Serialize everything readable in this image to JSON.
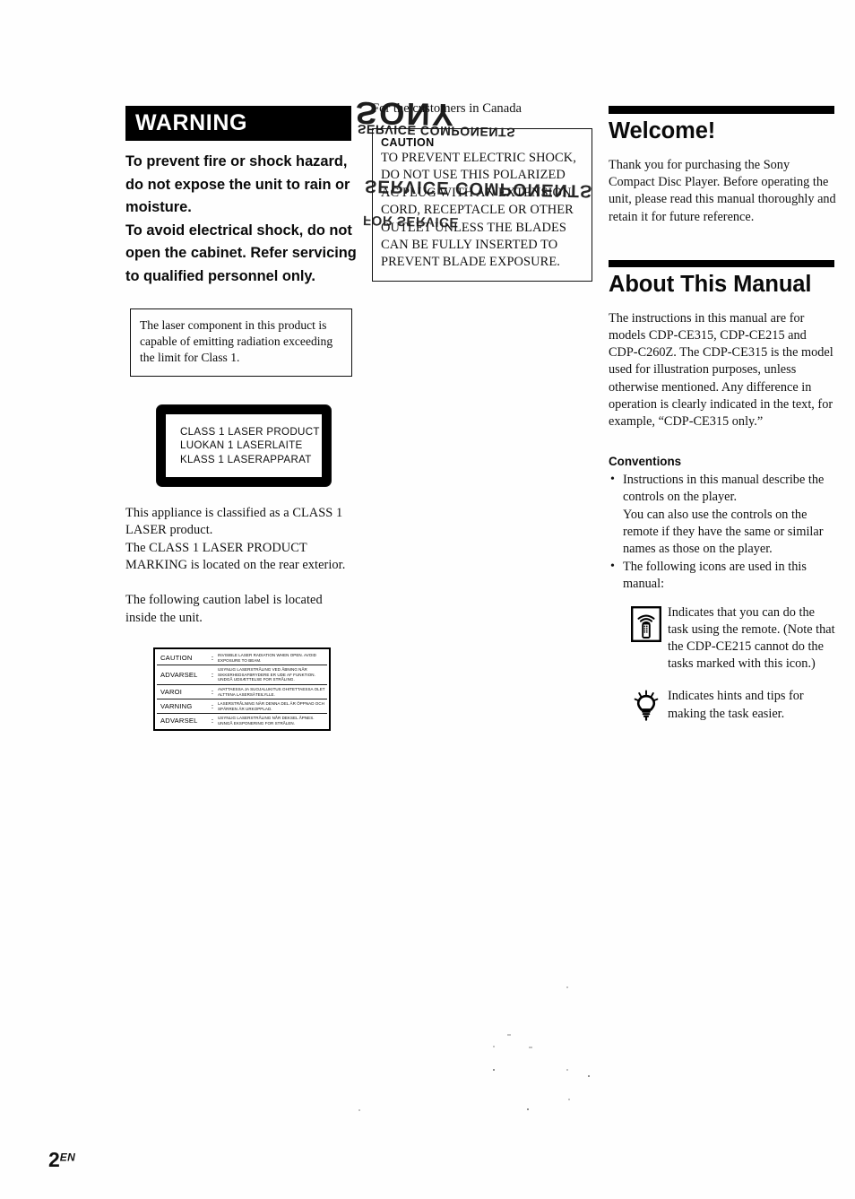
{
  "page": {
    "footer_number": "2",
    "footer_locale": "EN"
  },
  "left": {
    "warning_heading": "WARNING",
    "warning_body": "To prevent fire or shock hazard, do not expose the unit to rain or moisture.\nTo avoid electrical shock, do not open the cabinet. Refer servicing to qualified personnel only.",
    "warning_line1": "To prevent fire or shock hazard, do not expose the unit to rain or moisture.",
    "warning_line2": "To avoid electrical shock, do not open the cabinet. Refer servicing to qualified personnel only.",
    "laser_note": "The laser component in this product is capable of emitting radiation exceeding the limit for Class 1.",
    "laser_plate": {
      "line1": "CLASS 1 LASER PRODUCT",
      "line2": "LUOKAN 1 LASERLAITE",
      "line3": "KLASS 1 LASERAPPARAT"
    },
    "classification_para": "This appliance is classified as a CLASS 1 LASER product.\nThe CLASS 1 LASER PRODUCT MARKING is located on the rear exterior.",
    "classification_line1": "This appliance is classified as a CLASS 1 LASER product.",
    "classification_line2": "The CLASS 1 LASER PRODUCT MARKING is located on the rear exterior.",
    "caution_label_intro": "The following caution label is located inside the unit.",
    "caution_label_rows": [
      {
        "lang": "CAUTION",
        "colon": ":",
        "message": "INVISIBLE LASER RADIATION WHEN OPEN. AVOID EXPOSURE TO BEAM."
      },
      {
        "lang": "ADVARSEL",
        "colon": ":",
        "message": "USYNLIG LASERSTRÅLING VED ÅBNING NÅR SIKKERHEDSAFBRYDERE ER UDE AF FUNKTION. UNDGÅ UDSÆTTELSE FOR STRÅLING."
      },
      {
        "lang": "VAROI",
        "colon": ":",
        "message": "AVATTAESSA JA SUOJALUKITUS OHITETTAESSA OLET ALTTIINA LASERSÄTEILYLLE."
      },
      {
        "lang": "VARNING",
        "colon": ":",
        "message": "LASERSTRÅLNING NÄR DENNA DEL ÄR ÖPPNAD OCH SPÄRREN ÄR URKOPPLAD."
      },
      {
        "lang": "ADVARSEL",
        "colon": ":",
        "message": "USYNLIG LASERSTRÅLING NÅR DEKSEL ÅPNES. UNNGÅ EKSPONERING FOR STRÅLEN."
      }
    ]
  },
  "center": {
    "canada_heading": "For the customers in Canada",
    "caution_word": "CAUTION",
    "caution_body": "TO PREVENT ELECTRIC SHOCK, DO NOT USE THIS POLARIZED AC PLUG WITH AN EXTENSION CORD, RECEPTACLE OR OTHER OUTLET UNLESS THE BLADES CAN BE FULLY INSERTED TO PREVENT BLADE EXPOSURE.",
    "scan_bleed": {
      "logo": "SONY",
      "sub": "SERVICE COMPONENTS",
      "mid": "SERVICE COMPONENTS",
      "small": "FOR SERVICE"
    }
  },
  "right": {
    "welcome_heading": "Welcome!",
    "welcome_body": "Thank you for purchasing the Sony Compact Disc Player. Before operating the unit, please read this manual thoroughly and retain it for future reference.",
    "about_heading": "About This Manual",
    "about_body": "The instructions in this manual are for models CDP-CE315, CDP-CE215 and CDP-C260Z. The CDP-CE315 is the model used for illustration purposes, unless otherwise mentioned. Any difference in operation is clearly indicated in the text, for example, “CDP-CE315 only.”",
    "conventions_title": "Conventions",
    "bullet_1_main": "Instructions in this manual describe the controls on the player.",
    "bullet_1_sub": "You can also use the controls on the remote if they have the same or similar names as those on the player.",
    "bullet_2": "The following icons are used in this manual:",
    "icon_remote_text": "Indicates that you can do the task using the remote. (Note that the CDP-CE215 cannot do the tasks marked with this icon.)",
    "icon_hint_text": "Indicates hints and tips for making the task easier."
  }
}
